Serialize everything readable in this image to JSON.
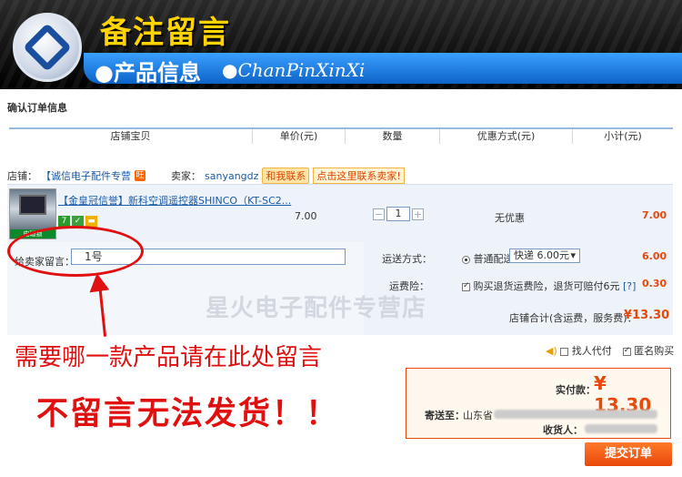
{
  "banner": {
    "title": "备注留言",
    "subtitle_cn": "●产品信息",
    "subtitle_pinyin": "●ChanPinXinXi"
  },
  "section_title": "确认订单信息",
  "table_headers": [
    "店铺宝贝",
    "单价(元)",
    "数量",
    "优惠方式(元)",
    "小计(元)"
  ],
  "shop": {
    "label": "店铺：",
    "name": "【诚信电子配件专营",
    "seller_label": "卖家：",
    "seller_name": "sanyangdz",
    "contact_label": "和我联系",
    "contact_hint": "点击这里联系卖家!"
  },
  "item": {
    "name": "【金皇冠信誉】新科空调遥控器SHINCO（KT-SC2...",
    "price": "7.00",
    "quantity": "1",
    "discount": "无优惠",
    "subtotal": "7.00",
    "badge_seven": "7",
    "thumb_tag": "电磁锁"
  },
  "message": {
    "label": "给卖家留言：",
    "value": "1号"
  },
  "shipping": {
    "label": "运送方式：",
    "option": "普通配送",
    "select_value": "快递 6.00元",
    "fee": "6.00"
  },
  "insurance": {
    "label": "运费险：",
    "text": "购买退货运费险，退货可赔付6元",
    "help": "[?]",
    "fee": "0.30"
  },
  "shop_total": {
    "label": "店铺合计(含运费，服务费)：",
    "currency": "¥",
    "value": "13.30"
  },
  "watermark": "星火电子配件专营店",
  "annotations": {
    "note1": "需要哪一款产品请在此处留言",
    "note2": "不留言无法发货！！"
  },
  "options": {
    "proxy_label": "找人代付",
    "anonymous_label": "匿名购买"
  },
  "confirm": {
    "pay_label": "实付款：",
    "currency": "¥",
    "pay_value": "13.30",
    "ship_to_label": "寄送至：",
    "ship_to_value": "山东省",
    "receiver_label": "收货人："
  },
  "submit_label": "提交订单",
  "colors": {
    "accent": "#e8480a",
    "annotation": "#e01010",
    "link": "#1a5aa6",
    "banner_blue": "#0d63c8",
    "banner_yellow": "#ffd400"
  }
}
